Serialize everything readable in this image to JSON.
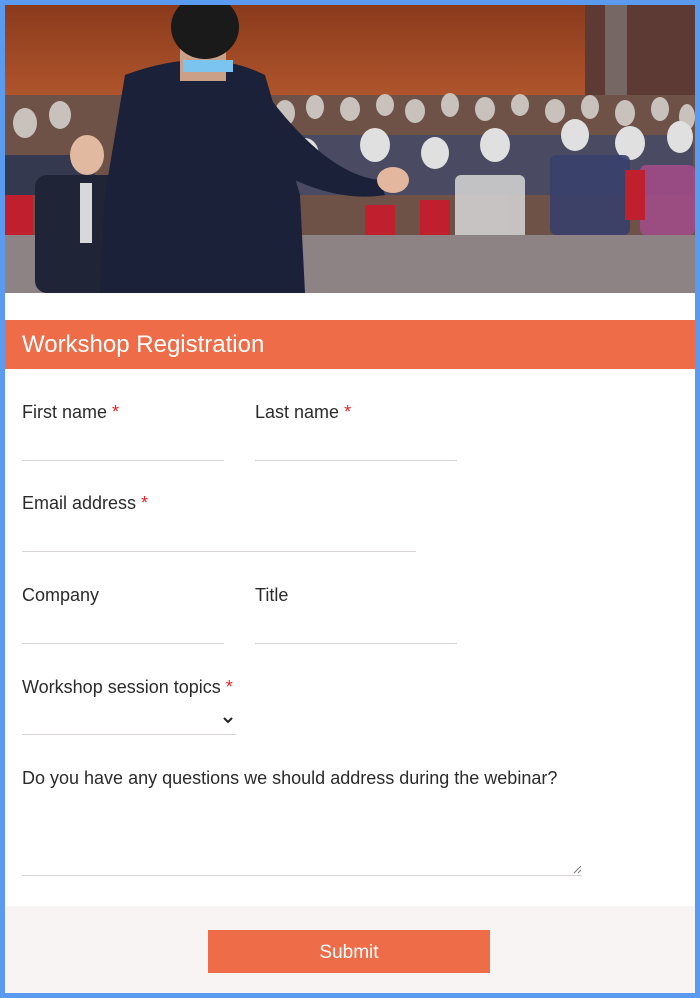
{
  "header": {
    "title": "Workshop Registration"
  },
  "required_marker": "*",
  "fields": {
    "first_name": {
      "label": "First name",
      "value": ""
    },
    "last_name": {
      "label": "Last name",
      "value": ""
    },
    "email": {
      "label": "Email address",
      "value": ""
    },
    "company": {
      "label": "Company",
      "value": ""
    },
    "title": {
      "label": "Title",
      "value": ""
    },
    "session_topics": {
      "label": "Workshop session topics",
      "selected": ""
    },
    "questions": {
      "label": "Do you have any questions we should address during the webinar?",
      "value": ""
    }
  },
  "footer": {
    "submit_label": "Submit"
  },
  "colors": {
    "accent": "#ee6c48",
    "frame": "#5b9bef",
    "required": "#e2232a"
  },
  "icons": {
    "select": "chevron-down-icon",
    "textarea": "resize-grip-icon"
  }
}
